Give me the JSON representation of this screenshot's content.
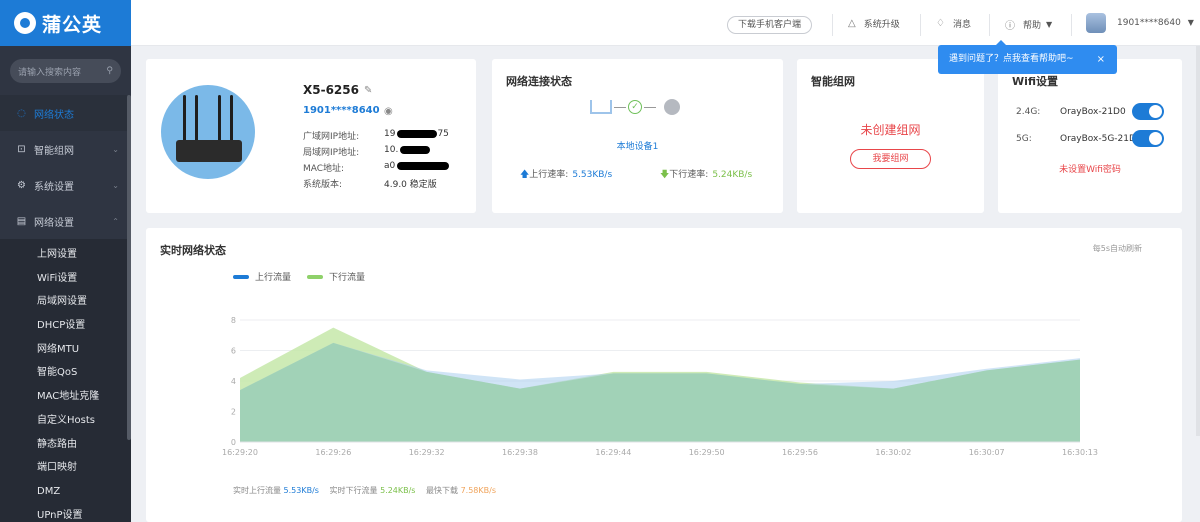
{
  "sidebar": {
    "brand": "蒲公英",
    "search_placeholder": "请输入搜索内容",
    "menu": [
      {
        "label": "网络状态",
        "icon": "network-status-icon",
        "active": true
      },
      {
        "label": "智能组网",
        "icon": "mesh-icon"
      },
      {
        "label": "系统设置",
        "icon": "gear-icon"
      },
      {
        "label": "网络设置",
        "icon": "settings-doc-icon",
        "expanded": true
      }
    ],
    "submenu": [
      "上网设置",
      "WiFi设置",
      "局域网设置",
      "DHCP设置",
      "网络MTU",
      "智能QoS",
      "MAC地址克隆",
      "自定义Hosts",
      "静态路由",
      "端口映射",
      "DMZ",
      "UPnP设置"
    ]
  },
  "topbar": {
    "download_app": "下载手机客户端",
    "upgrade": "系统升级",
    "messages": "消息",
    "help": "帮助",
    "user": "1901****8640"
  },
  "tooltip": {
    "text": "遇到问题了？点我查看帮助吧~",
    "close": "×"
  },
  "device": {
    "name": "X5-6256",
    "account": "1901****8640",
    "rows": [
      {
        "label": "广域网IP地址:",
        "value": "19",
        "value_tail": "75"
      },
      {
        "label": "局域网IP地址:",
        "value": "10."
      },
      {
        "label": "MAC地址:",
        "value": "a0"
      },
      {
        "label": "系统版本:",
        "value": "4.9.0 稳定版"
      }
    ]
  },
  "network": {
    "title": "网络连接状态",
    "local_device": "本地设备1",
    "upload_label": "上行速率:",
    "upload_value": "5.53KB/s",
    "download_label": "下行速率:",
    "download_value": "5.24KB/s"
  },
  "mesh": {
    "title": "智能组网",
    "status": "未创建组网",
    "button": "我要组网"
  },
  "wifi": {
    "title": "Wifi设置",
    "bands": [
      {
        "band": "2.4G:",
        "ssid": "OrayBox-21D0",
        "enabled": true
      },
      {
        "band": "5G:",
        "ssid": "OrayBox-5G-21D",
        "enabled": true
      }
    ],
    "warning": "未设置Wifi密码"
  },
  "realtime": {
    "title": "实时网络状态",
    "auto_refresh": "每5s自动刷新",
    "legend_up": "上行流量",
    "legend_down": "下行流量",
    "footer_up_label": "实时上行流量",
    "footer_up_value": "5.53KB/s",
    "footer_down_label": "实时下行流量",
    "footer_down_value": "5.24KB/s",
    "footer_max_label": "最快下载",
    "footer_max_value": "7.58KB/s"
  },
  "colors": {
    "brand": "#1d7bd6",
    "upload": "#1d7bd6",
    "download": "#7cc04b",
    "warning": "#e8464a"
  },
  "chart_data": {
    "type": "area",
    "x": [
      "16:29:20",
      "16:29:26",
      "16:29:32",
      "16:29:38",
      "16:29:44",
      "16:29:50",
      "16:29:56",
      "16:30:02",
      "16:30:07",
      "16:30:13"
    ],
    "series": [
      {
        "name": "上行流量",
        "values": [
          3.4,
          6.5,
          4.7,
          4.1,
          4.5,
          4.5,
          3.8,
          4.0,
          4.8,
          5.5
        ]
      },
      {
        "name": "下行流量",
        "values": [
          4.2,
          7.5,
          4.6,
          3.5,
          4.6,
          4.6,
          3.9,
          3.5,
          4.7,
          5.4
        ]
      }
    ],
    "ylim": [
      0,
      8
    ],
    "yticks": [
      0,
      2,
      4,
      6,
      8
    ],
    "grid": true,
    "legend": "top-left"
  }
}
